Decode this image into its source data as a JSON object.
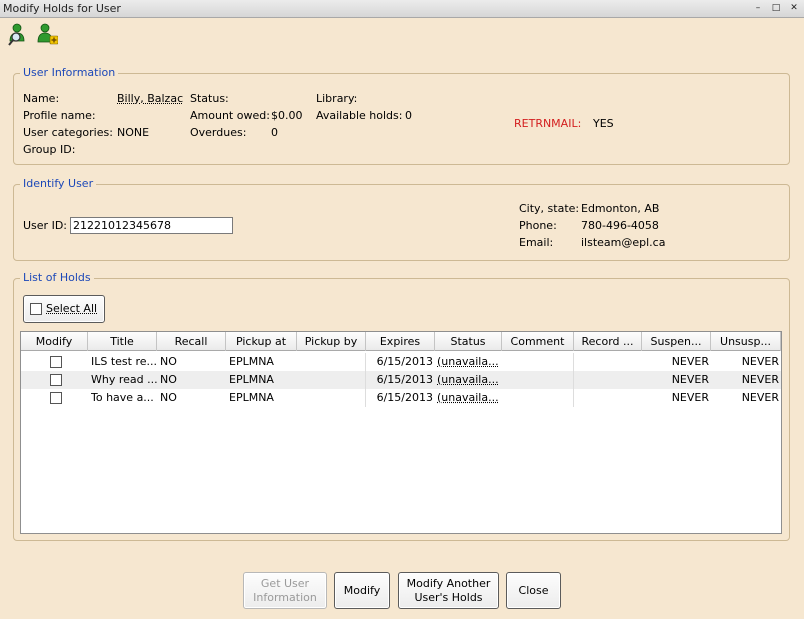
{
  "window": {
    "title": "Modify Holds for User",
    "controls": [
      "–",
      "□",
      "✕"
    ]
  },
  "toolbar": {
    "icons": [
      "user-search-icon",
      "user-add-icon"
    ]
  },
  "user_information": {
    "legend": "User Information",
    "name_label": "Name:",
    "name_value": "Billy, Balzac",
    "profile_label": "Profile name:",
    "categories_label": "User categories:",
    "categories_value": "NONE",
    "group_label": "Group ID:",
    "status_label": "Status:",
    "amount_owed_label": "Amount owed:",
    "amount_owed_value": "$0.00",
    "overdues_label": "Overdues:",
    "overdues_value": "0",
    "library_label": "Library:",
    "available_holds_label": "Available holds:",
    "available_holds_value": "0",
    "retrnmail_label": "RETRNMAIL:",
    "retrnmail_value": "YES",
    "alert_color": "#d31e1e"
  },
  "identify_user": {
    "legend": "Identify User",
    "user_id_label": "User ID:",
    "user_id_value": "21221012345678",
    "city_label": "City, state:",
    "city_value": "Edmonton, AB",
    "phone_label": "Phone:",
    "phone_value": "780-496-4058",
    "email_label": "Email:",
    "email_value": "ilsteam@epl.ca"
  },
  "list_of_holds": {
    "legend": "List of Holds",
    "select_all_label": "Select All",
    "columns": [
      "Modify",
      "Title",
      "Recall",
      "Pickup at",
      "Pickup by",
      "Expires",
      "Status",
      "Comment",
      "Record ...",
      "Suspen...",
      "Unsusp..."
    ],
    "rows": [
      {
        "title": "ILS test re...",
        "recall": "NO",
        "pickup_at": "EPLMNA",
        "pickup_by": "",
        "expires": "6/15/2013",
        "status": "(unavaila...",
        "comment": "",
        "record": "",
        "suspend": "NEVER",
        "unsuspend": "NEVER"
      },
      {
        "title": "Why read ...",
        "recall": "NO",
        "pickup_at": "EPLMNA",
        "pickup_by": "",
        "expires": "6/15/2013",
        "status": "(unavaila...",
        "comment": "",
        "record": "",
        "suspend": "NEVER",
        "unsuspend": "NEVER"
      },
      {
        "title": "To have a...",
        "recall": "NO",
        "pickup_at": "EPLMNA",
        "pickup_by": "",
        "expires": "6/15/2013",
        "status": "(unavaila...",
        "comment": "",
        "record": "",
        "suspend": "NEVER",
        "unsuspend": "NEVER"
      }
    ]
  },
  "buttons": {
    "get_user_info": "Get User\nInformation",
    "modify": "Modify",
    "modify_another": "Modify Another\nUser's Holds",
    "close": "Close"
  },
  "colors": {
    "background": "#f6e7d0",
    "legend_text": "#1c48b8"
  }
}
